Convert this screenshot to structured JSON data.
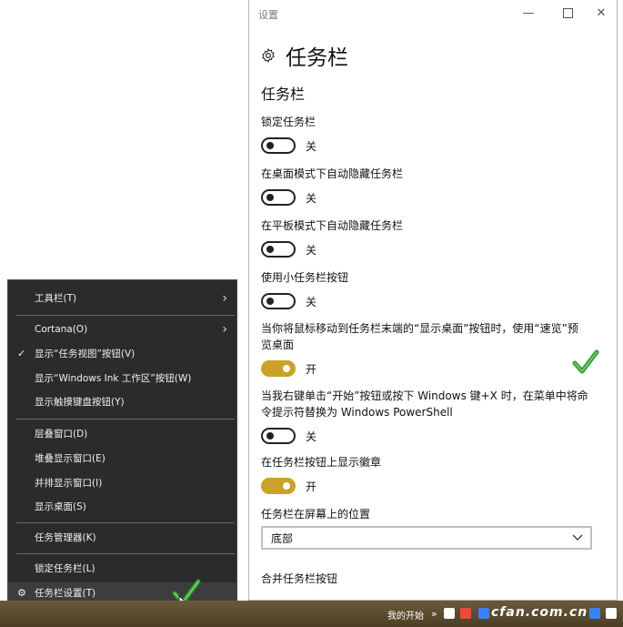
{
  "settings_window": {
    "title": "设置",
    "page_title": "任务栏",
    "section_title": "任务栏",
    "settings": [
      {
        "label": "锁定任务栏",
        "state": "关",
        "on": false
      },
      {
        "label": "在桌面模式下自动隐藏任务栏",
        "state": "关",
        "on": false
      },
      {
        "label": "在平板模式下自动隐藏任务栏",
        "state": "关",
        "on": false
      },
      {
        "label": "使用小任务栏按钮",
        "state": "关",
        "on": false
      },
      {
        "label": "当你将鼠标移动到任务栏末端的“显示桌面”按钮时，使用“速览”预览桌面",
        "state": "开",
        "on": true
      },
      {
        "label": "当我右键单击“开始”按钮或按下 Windows 键+X 时，在菜单中将命令提示符替换为 Windows PowerShell",
        "state": "关",
        "on": false
      },
      {
        "label": "在任务栏按钮上显示徽章",
        "state": "开",
        "on": true
      }
    ],
    "position_label": "任务栏在屏幕上的位置",
    "position_value": "底部",
    "combine_label": "合并任务栏按钮"
  },
  "context_menu": {
    "items": [
      {
        "label": "工具栏(T)",
        "submenu": true
      },
      {
        "label": "Cortana(O)",
        "submenu": true
      },
      {
        "label": "显示“任务视图”按钮(V)",
        "checked": true
      },
      {
        "label": "显示“Windows Ink 工作区”按钮(W)"
      },
      {
        "label": "显示触摸键盘按钮(Y)"
      },
      {
        "label": "层叠窗口(D)"
      },
      {
        "label": "堆叠显示窗口(E)"
      },
      {
        "label": "并排显示窗口(I)"
      },
      {
        "label": "显示桌面(S)"
      },
      {
        "label": "任务管理器(K)"
      },
      {
        "label": "锁定任务栏(L)"
      },
      {
        "label": "任务栏设置(T)",
        "icon": "gear-icon",
        "highlighted": true
      }
    ]
  },
  "taskbar": {
    "start_label": "我的开始",
    "brand": "cfan.com.cn"
  },
  "colors": {
    "toggle_on": "#c9a227",
    "menu_bg": "#2b2b2b",
    "check_green": "#2e9e2e"
  }
}
